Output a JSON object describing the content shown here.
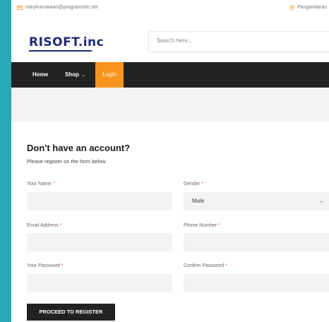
{
  "topbar": {
    "email": "riskykurniawan@programmer.net",
    "location": "Pangandaran"
  },
  "header": {
    "logo": "RISOFT.inc",
    "search_placeholder": "Search here..."
  },
  "nav": {
    "home": "Home",
    "shop": "Shop",
    "login": "Login"
  },
  "register": {
    "heading": "Don't have an account?",
    "subheading": "Please register on the form below",
    "name_label": "Your Name",
    "gender_label": "Gender",
    "gender_value": "Male",
    "email_label": "Email Address",
    "phone_label": "Phone Number",
    "password_label": "Your Password",
    "confirm_label": "Confirm Password",
    "required_mark": "*",
    "submit": "PROCEED TO REGISTER"
  },
  "colors": {
    "background": "#29a9b5",
    "nav_bg": "#222222",
    "accent": "#f7941d",
    "logo": "#1e2a78",
    "required": "#e74c3c"
  },
  "icons": {
    "email": "mail-icon",
    "location": "map-pin-icon",
    "shop_dropdown": "chevron-down-icon",
    "gender_dropdown": "chevron-down-icon"
  }
}
